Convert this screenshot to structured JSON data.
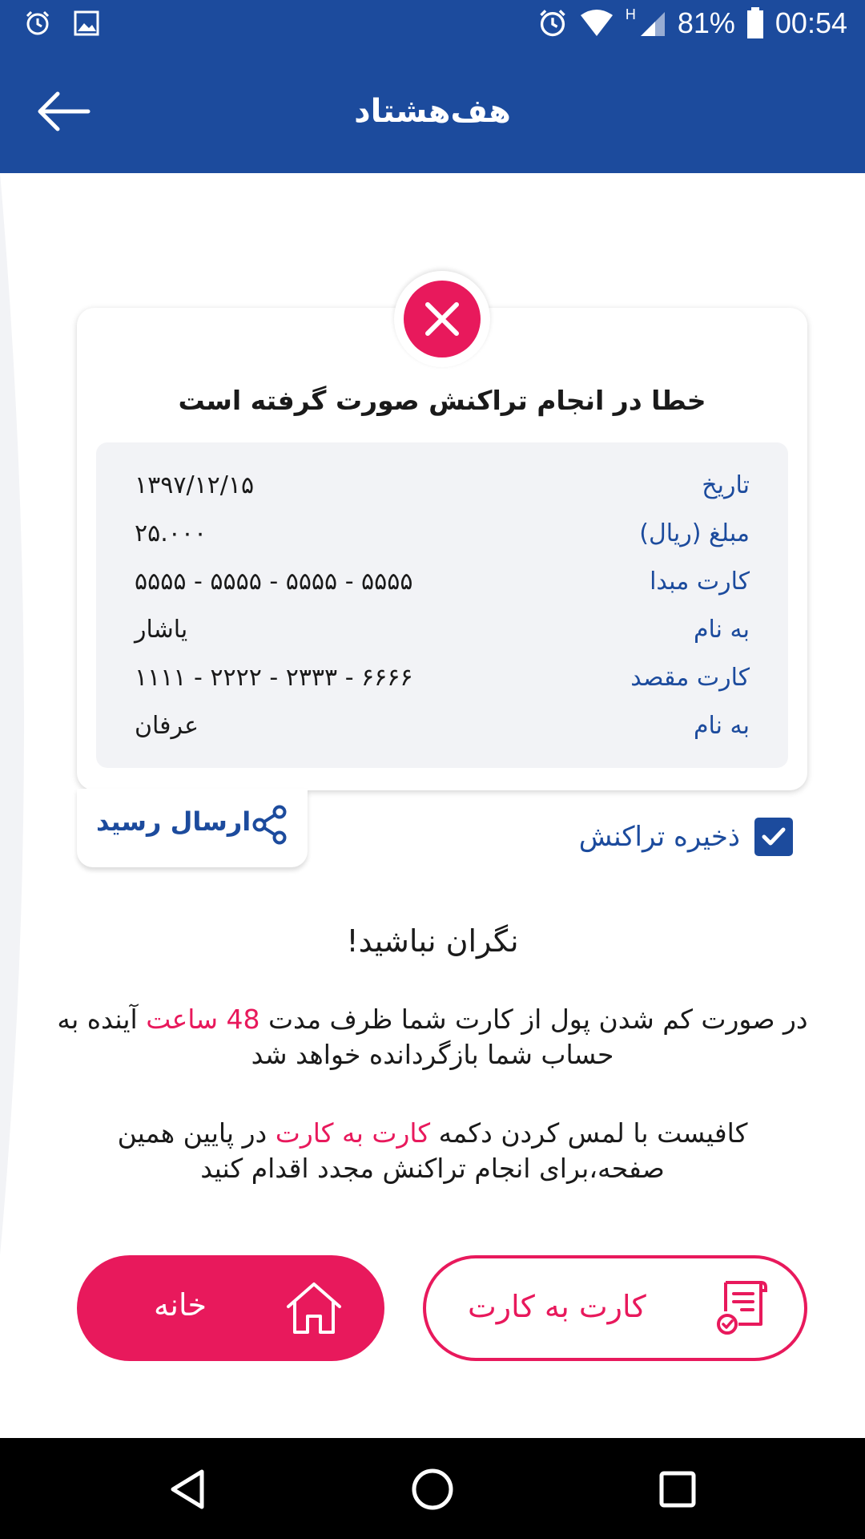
{
  "status_bar": {
    "battery": "81%",
    "time": "00:54",
    "network": "H",
    "icons": [
      "alarm-icon",
      "image-icon",
      "alarm-icon",
      "wifi-icon",
      "signal-icon",
      "battery-icon"
    ]
  },
  "header": {
    "title": "هف‌هشتاد",
    "back_icon": "arrow-left-icon"
  },
  "result": {
    "status_icon": "close-icon",
    "title": "خطا در انجام تراکنش صورت گرفته است",
    "rows": [
      {
        "label": "تاریخ",
        "value": "۱۳۹۷/۱۲/۱۵"
      },
      {
        "label": "مبلغ (ریال)",
        "value": "۲۵.۰۰۰"
      },
      {
        "label": "کارت مبدا",
        "value": "۵۵۵۵ - ۵۵۵۵ - ۵۵۵۵ - ۵۵۵۵"
      },
      {
        "label": "به نام",
        "value": "یاشار"
      },
      {
        "label": "کارت مقصد",
        "value": "۱۱۱۱ - ۲۲۲۲ - ۲۳۳۳ - ۶۶۶۶"
      },
      {
        "label": "به نام",
        "value": "عرفان"
      }
    ]
  },
  "actions": {
    "share_label": "ارسال رسید",
    "share_icon": "share-icon",
    "save_label": "ذخیره تراکنش",
    "save_checked": true
  },
  "info": {
    "title": "نگران نباشید!",
    "para1_before": "در صورت کم شدن پول از کارت شما ظرف مدت",
    "para1_highlight": "48 ساعت",
    "para1_after": "آینده به حساب شما بازگردانده خواهد شد",
    "para2_before": "کافیست با لمس کردن دکمه",
    "para2_highlight": "کارت به کارت",
    "para2_after": "در پایین همین صفحه،برای انجام تراکنش مجدد اقدام کنید"
  },
  "buttons": {
    "home_label": "خانه",
    "home_icon": "home-icon",
    "card_label": "کارت به کارت",
    "card_icon": "receipt-icon"
  },
  "colors": {
    "primary": "#1c4b9d",
    "accent": "#e8195c",
    "panel": "#f2f3f6"
  },
  "nav": {
    "icons": [
      "back-triangle-icon",
      "home-circle-icon",
      "recents-square-icon"
    ]
  }
}
